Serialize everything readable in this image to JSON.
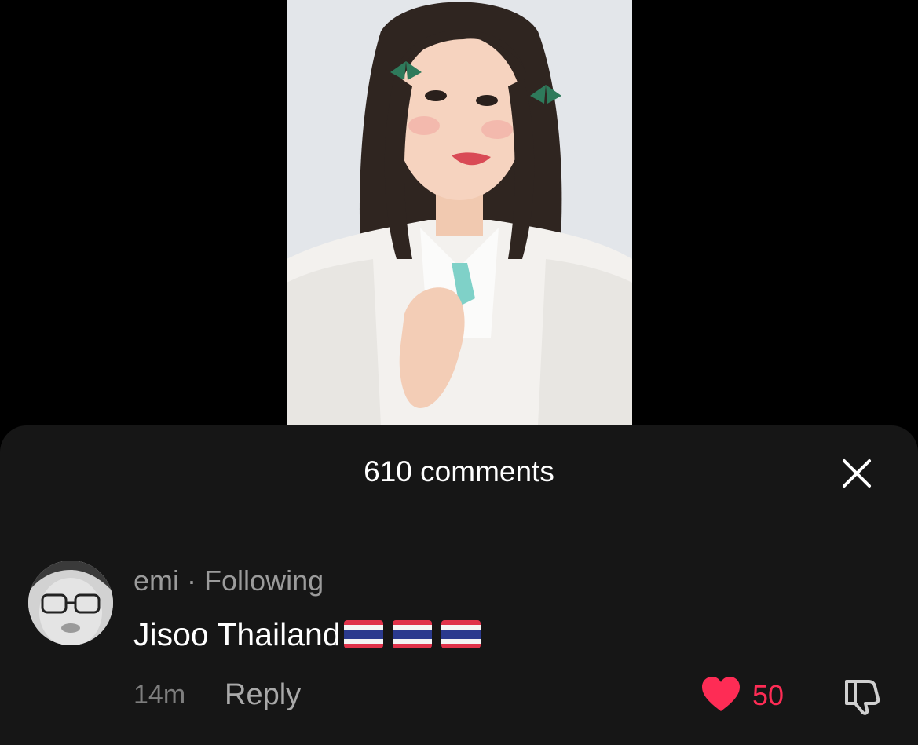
{
  "video": {
    "description_icon": "video-frame"
  },
  "comments_sheet": {
    "title": "610 comments",
    "close_icon": "close-icon"
  },
  "comment": {
    "username": "emi",
    "separator": "·",
    "relationship": "Following",
    "text": "Jisoo Thailand",
    "emoji": [
      "thailand-flag",
      "thailand-flag",
      "thailand-flag"
    ],
    "timestamp": "14m",
    "reply_label": "Reply",
    "like_count": "50",
    "like_icon": "heart-icon",
    "dislike_icon": "thumbs-down-icon"
  },
  "colors": {
    "background": "#000000",
    "sheet": "#161616",
    "like": "#fe2c55",
    "muted": "#9b9b9b"
  }
}
